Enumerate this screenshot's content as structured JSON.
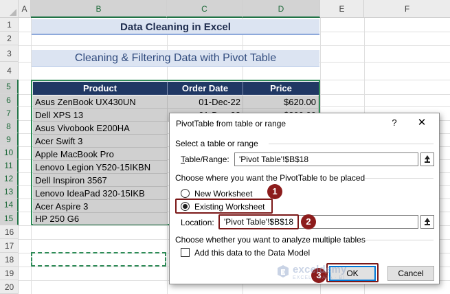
{
  "spreadsheet": {
    "columns": [
      "A",
      "B",
      "C",
      "D",
      "E",
      "F"
    ],
    "rows": [
      "1",
      "2",
      "3",
      "4",
      "5",
      "6",
      "7",
      "8",
      "9",
      "10",
      "11",
      "12",
      "13",
      "14",
      "15",
      "16",
      "17",
      "18",
      "19",
      "20"
    ]
  },
  "title": "Data Cleaning in Excel",
  "subtitle": "Cleaning & Filtering Data with Pivot Table",
  "table": {
    "headers": [
      "Product",
      "Order Date",
      "Price"
    ],
    "rows": [
      [
        "Asus ZenBook UX430UN",
        "01-Dec-22",
        "$620.00"
      ],
      [
        "Dell XPS 13",
        "01-Dec-22",
        "$800.00"
      ],
      [
        "Asus Vivobook E200HA",
        "",
        ""
      ],
      [
        "Acer Swift 3",
        "",
        ""
      ],
      [
        "Apple MacBook Pro",
        "",
        ""
      ],
      [
        "Lenovo Legion Y520-15IKBN",
        "",
        ""
      ],
      [
        "Dell Inspiron 3567",
        "",
        ""
      ],
      [
        "Lenovo IdeaPad 320-15IKB",
        "",
        ""
      ],
      [
        "Acer Aspire 3",
        "",
        ""
      ],
      [
        "HP 250 G6",
        "",
        ""
      ]
    ]
  },
  "dialog": {
    "title": "PivotTable from table or range",
    "help": "?",
    "close": "✕",
    "section_select": "Select a table or range",
    "table_range_label": "Table/Range:",
    "table_range_value": "'Pivot Table'!$B$18",
    "section_place": "Choose where you want the PivotTable to be placed",
    "new_worksheet": "New Worksheet",
    "existing_worksheet": "Existing Worksheet",
    "location_label": "Location:",
    "location_value": "'Pivot Table'!$B$18",
    "section_multi": "Choose whether you want to analyze multiple tables",
    "data_model_label": "Add this data to the Data Model",
    "ok": "OK",
    "cancel": "Cancel",
    "selected_option": "Existing Worksheet",
    "data_model_checked": false
  },
  "annotations": [
    "1",
    "2",
    "3"
  ],
  "watermark": {
    "name": "exceldemy",
    "tagline": "EXCEL · DATA · BI"
  },
  "colors": {
    "table_header_bg": "#203864",
    "cell_bg": "#d0d0d0",
    "table_border": "#2e8b57",
    "annotation": "#8c1c1c",
    "title_bg": "#dce4f2",
    "ok_border": "#0078d7"
  }
}
